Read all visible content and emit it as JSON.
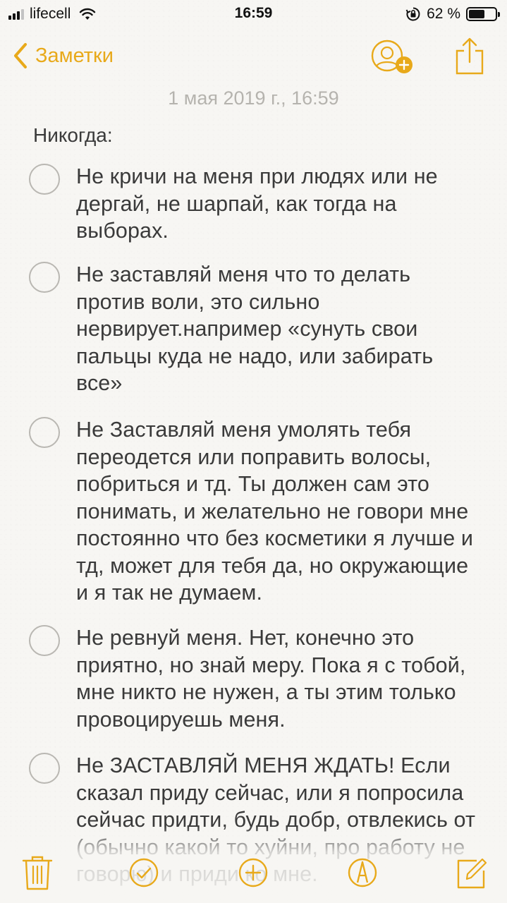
{
  "status_bar": {
    "carrier": "lifecell",
    "time": "16:59",
    "battery": "62 %",
    "battery_level": 0.62
  },
  "nav": {
    "back_label": "Заметки",
    "back_icon": "chevron-left-icon",
    "add_person_icon": "add-person-icon",
    "share_icon": "share-icon"
  },
  "note": {
    "date": "1 мая 2019 г., 16:59",
    "heading": "Никогда:",
    "items": [
      {
        "text": "Не кричи на меня при людях или не дергай, не шарпай, как тогда на выборах."
      },
      {
        "text": "Не заставляй меня что то делать против воли, это сильно нервирует.например «сунуть свои пальцы куда не надо, или забирать все»"
      },
      {
        "text": "Не Заставляй меня умолять тебя переодется или поправить волосы, побриться и тд. Ты должен сам это понимать, и желательно не говори мне постоянно что без косметики я лучше и тд, может для тебя да, но окружающие и я так не думаем."
      },
      {
        "text": "Не ревнуй меня. Нет, конечно это приятно, но знай меру. Пока я с тобой, мне никто не нужен, а ты этим только провоцируешь меня."
      },
      {
        "text": "Не ЗАСТАВЛЯЙ МЕНЯ ЖДАТЬ! Если сказал приду сейчас, или я попросила сейчас придти, будь добр, отвлекись от (обычно какой то хуйни, про работу не говорю) и приди ко мне."
      }
    ]
  },
  "toolbar": {
    "icons": [
      "trash-icon",
      "checklist-icon",
      "add-icon",
      "markup-icon",
      "compose-icon"
    ]
  },
  "colors": {
    "accent": "#e8a91a",
    "background": "#f7f6f3",
    "text": "#3a3a3a",
    "date_text": "#b5b3ae",
    "checkbox_border": "#b9b7b2"
  }
}
